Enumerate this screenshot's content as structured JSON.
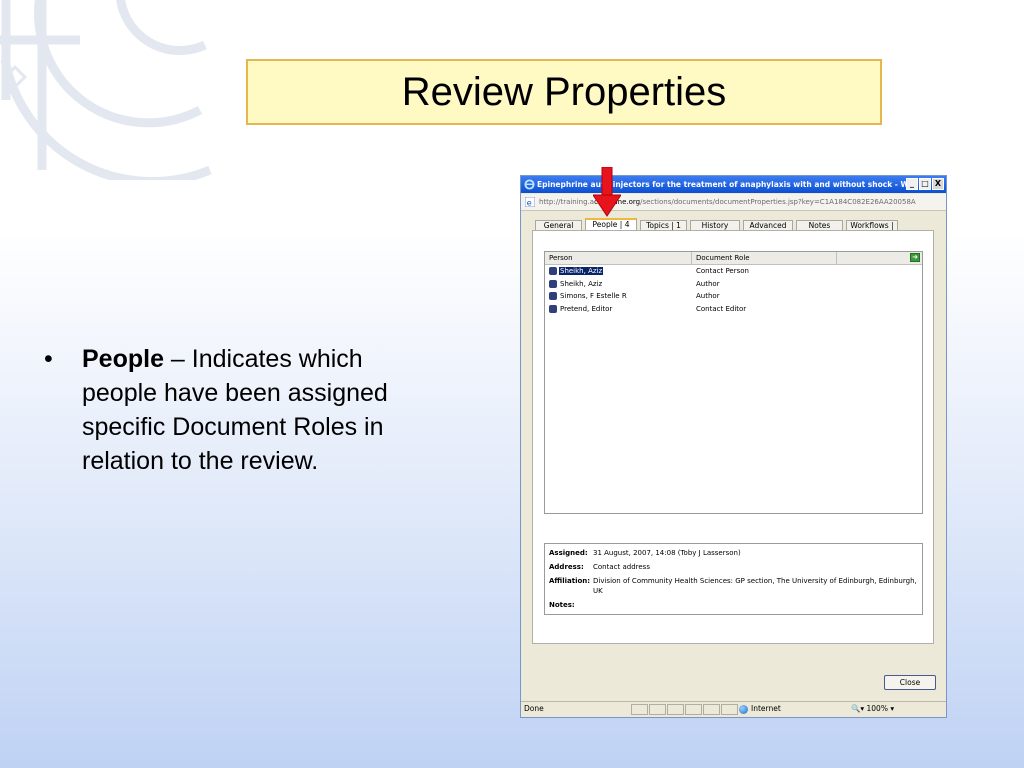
{
  "slide": {
    "title": "Review Properties",
    "bullet_term": "People",
    "bullet_text": " – Indicates which people have been assigned specific Document Roles in relation to the review."
  },
  "window": {
    "title": "Epinephrine auto-injectors for the treatment of anaphylaxis with and without shock - W...",
    "address_prefix": "http://training.a",
    "address_domain": "cochrane.org",
    "address_suffix": "/sections/documents/documentProperties.jsp?key=C1A184C082E26AA20058A",
    "minimize": "_",
    "maximize": "□",
    "close": "X"
  },
  "tabs": [
    {
      "label": "General"
    },
    {
      "label": "People | 4",
      "active": true
    },
    {
      "label": "Topics | 1"
    },
    {
      "label": "History"
    },
    {
      "label": "Advanced"
    },
    {
      "label": "Notes"
    },
    {
      "label": "Workflows | 2"
    }
  ],
  "people_grid": {
    "headers": {
      "person": "Person",
      "role": "Document Role"
    },
    "rows": [
      {
        "person": "Sheikh, Aziz",
        "role": "Contact Person",
        "selected": true
      },
      {
        "person": "Sheikh, Aziz",
        "role": "Author"
      },
      {
        "person": "Simons, F Estelle R",
        "role": "Author"
      },
      {
        "person": "Pretend, Editor",
        "role": "Contact Editor"
      }
    ]
  },
  "details": {
    "assigned_label": "Assigned:",
    "assigned_value": "31 August, 2007, 14:08 (Toby J Lasserson)",
    "address_label": "Address:",
    "address_value": "Contact address",
    "affiliation_label": "Affiliation:",
    "affiliation_value": "Division of Community Health Sciences: GP section, The University of Edinburgh, Edinburgh, UK",
    "notes_label": "Notes:"
  },
  "buttons": {
    "close": "Close"
  },
  "statusbar": {
    "status": "Done",
    "zone": "Internet",
    "zoom": "100%"
  },
  "icons": [
    "ie-icon",
    "user-icon",
    "export-icon",
    "globe-icon",
    "red-arrow-icon",
    "emblem-logo"
  ],
  "colors": {
    "title_bg": "#fff9c4",
    "title_border": "#e6b650",
    "titlebar": "#0a4fd2",
    "arrow": "#e8141c",
    "selection": "#0a246a"
  }
}
